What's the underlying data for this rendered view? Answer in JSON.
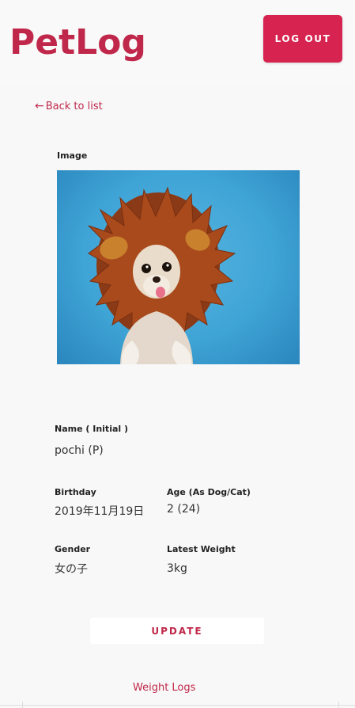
{
  "header": {
    "logo": "PetLog",
    "logout_label": "LOG OUT"
  },
  "nav": {
    "back_arrow": "←",
    "back_label": "Back to list"
  },
  "image_section": {
    "label": "Image",
    "image_alt": "pet photo"
  },
  "details": {
    "name_label": "Name ( Initial )",
    "name_value": "pochi (P)",
    "birthday_label": "Birthday",
    "birthday_value": "2019年11月19日",
    "age_label": "Age (As Dog/Cat)",
    "age_value": "2 (24)",
    "gender_label": "Gender",
    "gender_value": "女の子",
    "weight_label": "Latest Weight",
    "weight_value": "3kg"
  },
  "actions": {
    "update_label": "UPDATE",
    "weight_logs_label": "Weight Logs"
  },
  "colors": {
    "brand": "#c0284b",
    "button": "#d6234f",
    "image_bg": "#3fa4d6"
  },
  "icons": {
    "back": "left-arrow-icon"
  }
}
